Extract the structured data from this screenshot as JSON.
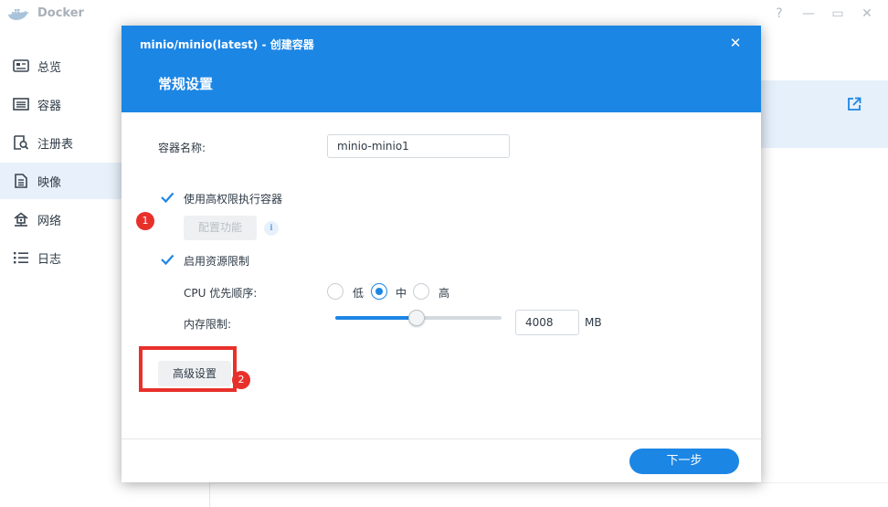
{
  "app": {
    "title": "Docker",
    "window_controls": [
      "?",
      "—",
      "▭",
      "✕"
    ]
  },
  "sidebar": {
    "items": [
      {
        "label": "总览",
        "icon": "overview-icon",
        "active": false
      },
      {
        "label": "容器",
        "icon": "container-icon",
        "active": false
      },
      {
        "label": "注册表",
        "icon": "registry-icon",
        "active": false
      },
      {
        "label": "映像",
        "icon": "image-icon",
        "active": true
      },
      {
        "label": "网络",
        "icon": "network-icon",
        "active": false
      },
      {
        "label": "日志",
        "icon": "log-icon",
        "active": false
      }
    ]
  },
  "dialog": {
    "title": "minio/minio(latest) - 创建容器",
    "close_glyph": "✕",
    "subtitle": "常规设置",
    "container_name_label": "容器名称:",
    "container_name_value": "minio-minio1",
    "privileged_label": "使用高权限执行容器",
    "privileged_checked": true,
    "config_button": "配置功能",
    "info_glyph": "i",
    "resource_limit_label": "启用资源限制",
    "resource_limit_checked": true,
    "cpu_label": "CPU 优先顺序:",
    "cpu_options": [
      "低",
      "中",
      "高"
    ],
    "cpu_selected": "中",
    "memory_label": "内存限制:",
    "memory_value": "4008",
    "memory_unit": "MB",
    "memory_slider_fraction": 0.49,
    "advanced_button": "高级设置",
    "next_button": "下一步"
  },
  "annotations": {
    "badge_1": "1",
    "badge_2": "2",
    "highlight_color": "#e8302b"
  },
  "colors": {
    "accent": "#1c86e5",
    "annotation_red": "#e8302b",
    "active_nav_bg": "#e8f1fb"
  }
}
